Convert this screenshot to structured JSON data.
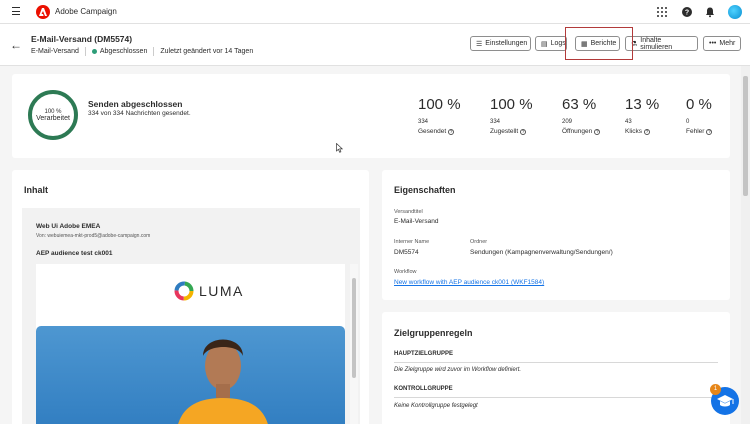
{
  "topbar": {
    "app_name": "Adobe Campaign"
  },
  "header": {
    "title": "E-Mail-Versand (DM5574)",
    "type": "E-Mail-Versand",
    "status": "Abgeschlossen",
    "modified": "Zuletzt geändert vor 14 Tagen",
    "buttons": {
      "settings": "Einstellungen",
      "logs": "Logs",
      "reports": "Berichte",
      "simulate": "Inhalte simulieren",
      "more": "Mehr"
    }
  },
  "summary": {
    "ring_pct": "100 %",
    "ring_label": "Verarbeitet",
    "title": "Senden abgeschlossen",
    "subtitle": "334 von 334 Nachrichten gesendet.",
    "metrics": [
      {
        "pct": "100 %",
        "count": "334",
        "label": "Gesendet"
      },
      {
        "pct": "100 %",
        "count": "334",
        "label": "Zugestellt"
      },
      {
        "pct": "63 %",
        "count": "209",
        "label": "Öffnungen"
      },
      {
        "pct": "13 %",
        "count": "43",
        "label": "Klicks"
      },
      {
        "pct": "0 %",
        "count": "0",
        "label": "Fehler"
      }
    ]
  },
  "content": {
    "heading": "Inhalt",
    "from_name": "Web Ui Adobe EMEA",
    "from_addr": "Von: webuiemea-mkt-prod5@adobe-campaign.com",
    "subject": "AEP audience test ck001",
    "brand": "LUMA"
  },
  "properties": {
    "heading": "Eigenschaften",
    "delivery_title_label": "Versandtitel",
    "delivery_title": "E-Mail-Versand",
    "internal_name_label": "Interner Name",
    "internal_name": "DM5574",
    "folder_label": "Ordner",
    "folder": "Sendungen (Kampagnenverwaltung/Sendungen/)",
    "workflow_label": "Workflow",
    "workflow": "New workflow with AEP audience ck001 (WKF1584)"
  },
  "rules": {
    "heading": "Zielgruppenregeln",
    "main_label": "HAUPTZIELGRUPPE",
    "main_desc": "Die Zielgruppe wird zuvor im Workflow definiert.",
    "control_label": "KONTROLLGRUPPE",
    "control_desc": "Keine Kontrollgruppe festgelegt"
  },
  "help_badge": "1",
  "colors": {
    "accent": "#1473e6",
    "brand_red": "#eb1000",
    "status_green": "#2d9d78",
    "highlight": "#b23a3a"
  }
}
